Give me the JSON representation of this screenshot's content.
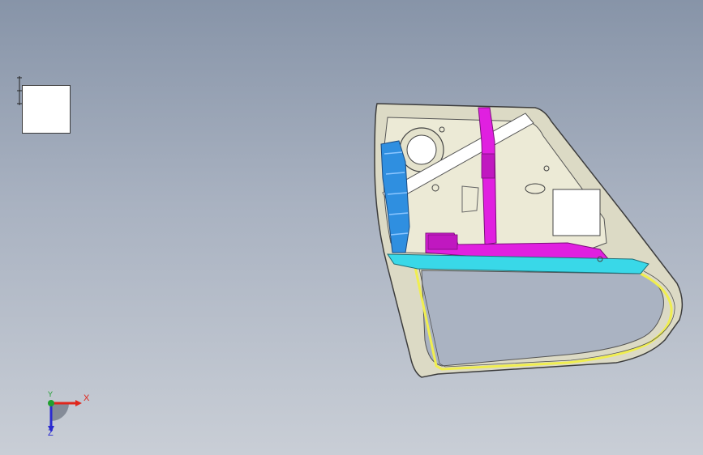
{
  "viewport": {
    "background_top": "#8794a8",
    "background_bottom": "#c9ced6"
  },
  "model": {
    "colors": {
      "panel": "#e8e6d2",
      "outline": "#3c3c3c",
      "magenta": "#e020e0",
      "blue": "#2f8fe0",
      "cyan": "#39d8e8",
      "yellow": "#f0ee50",
      "white": "#ffffff"
    }
  },
  "triad": {
    "x_label": "X",
    "y_label": "Y",
    "z_label": "Z",
    "x_color": "#e0261b",
    "y_color": "#20a030",
    "z_color": "#2a2ad0"
  }
}
